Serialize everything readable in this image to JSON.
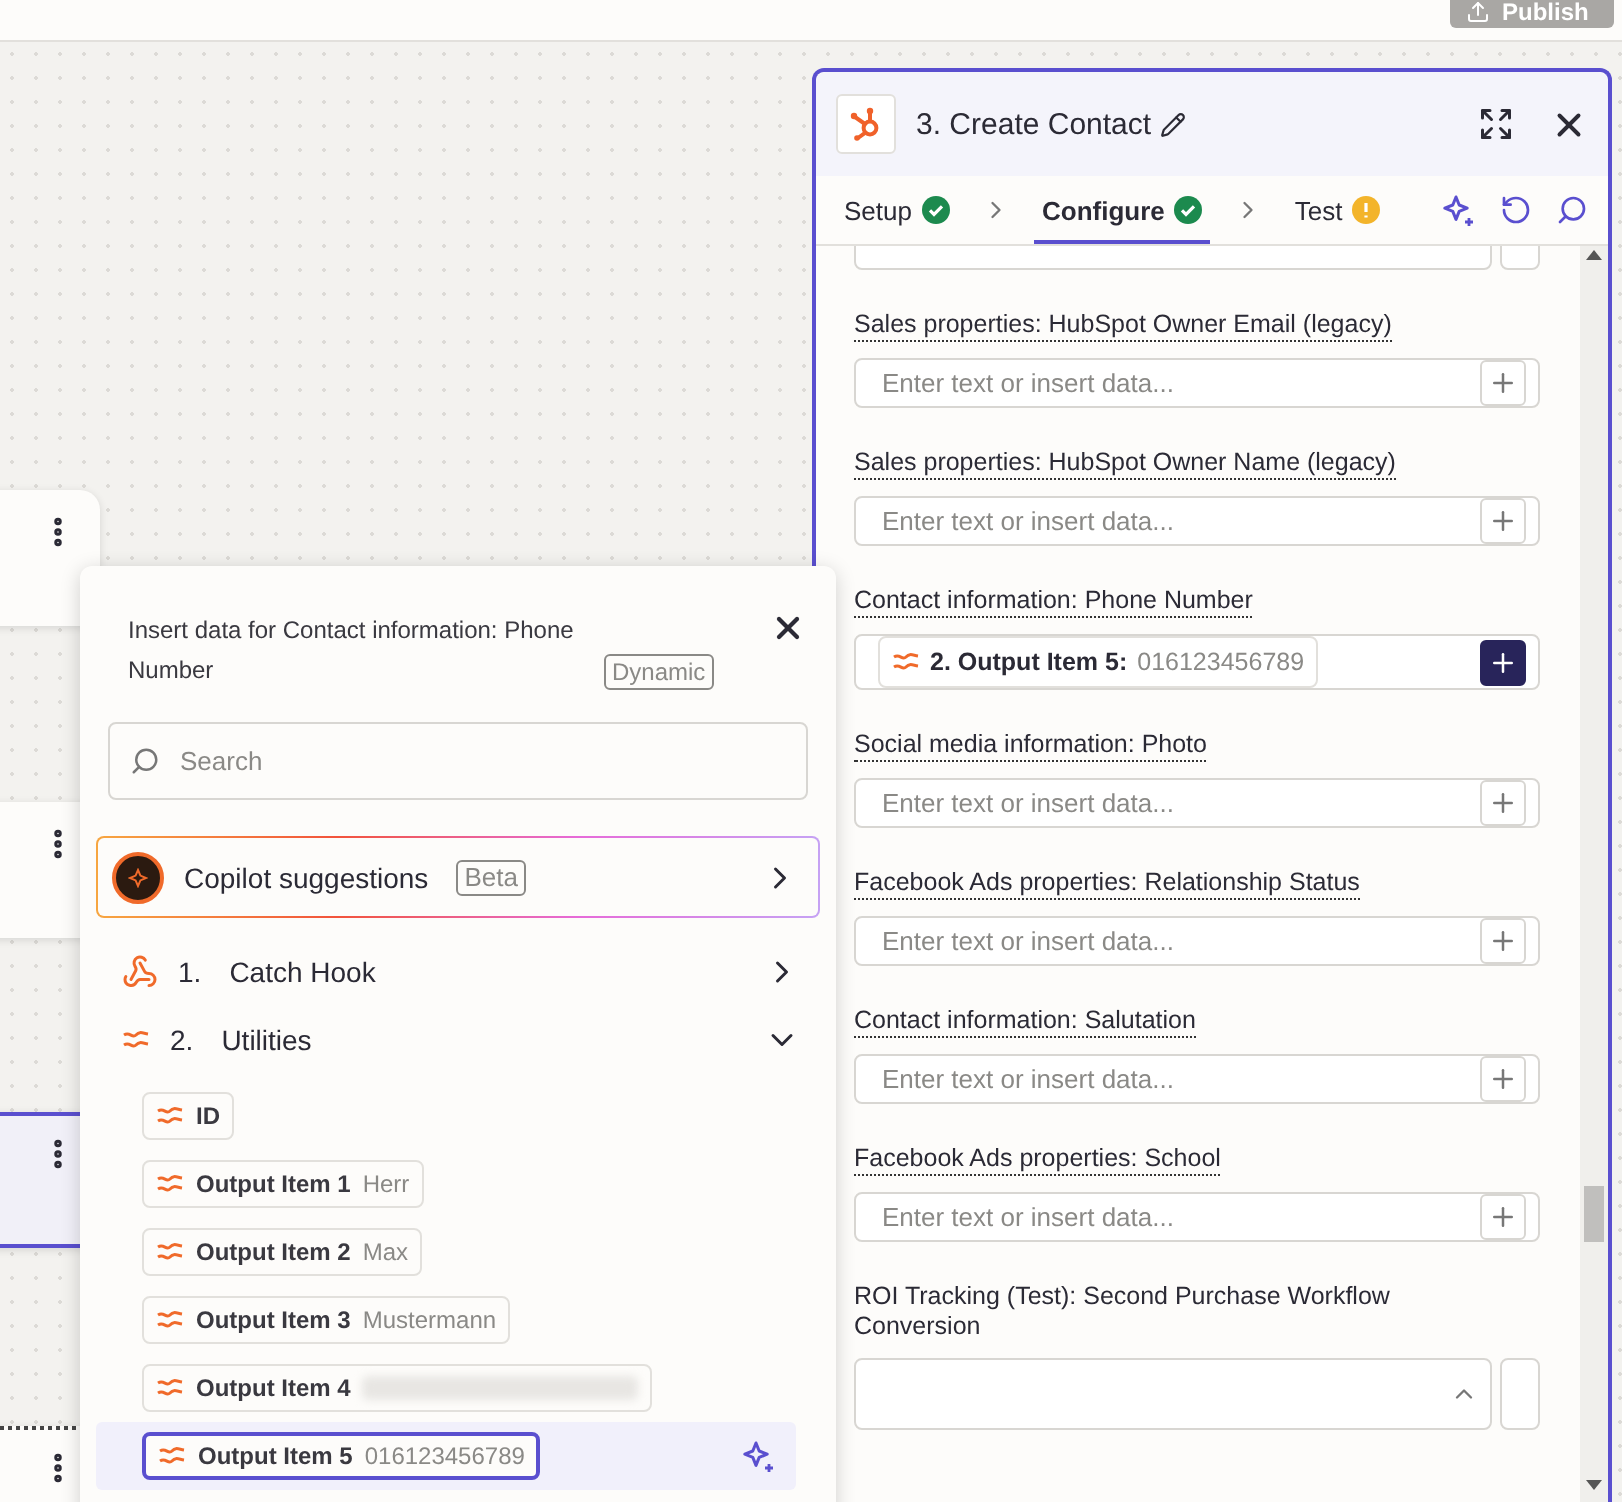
{
  "publish_button": {
    "label": "Publish"
  },
  "canvas": {
    "nodes": [
      {
        "selected": false
      },
      {
        "selected": false
      },
      {
        "selected": true
      },
      {
        "selected": false
      }
    ]
  },
  "panel": {
    "title": "3. Create Contact",
    "tabs": [
      {
        "label": "Setup",
        "kind": "done",
        "selected": false
      },
      {
        "label": "Configure",
        "kind": "done",
        "selected": true
      },
      {
        "label": "Test",
        "kind": "warning",
        "selected": false
      }
    ],
    "fields": [
      {
        "kind": "text",
        "label": "Sales properties: HubSpot Owner Email (legacy)",
        "placeholder": "Enter text or insert data..."
      },
      {
        "kind": "text",
        "label": "Sales properties: HubSpot Owner Name (legacy)",
        "placeholder": "Enter text or insert data..."
      },
      {
        "kind": "mapped",
        "label": "Contact information: Phone Number",
        "token": {
          "step": "2. Output Item 5:",
          "value": "016123456789"
        }
      },
      {
        "kind": "text",
        "label": "Social media information: Photo",
        "placeholder": "Enter text or insert data..."
      },
      {
        "kind": "text",
        "label": "Facebook Ads properties: Relationship Status",
        "placeholder": "Enter text or insert data..."
      },
      {
        "kind": "text",
        "label": "Contact information: Salutation",
        "placeholder": "Enter text or insert data..."
      },
      {
        "kind": "text",
        "label": "Facebook Ads properties: School",
        "placeholder": "Enter text or insert data..."
      },
      {
        "kind": "select",
        "label": "ROI Tracking (Test): Second Purchase Workflow Conversion"
      }
    ]
  },
  "popover": {
    "title": "Insert data for Contact information: Phone Number",
    "badge": "Dynamic",
    "search": {
      "placeholder": "Search"
    },
    "copilot": {
      "label": "Copilot suggestions",
      "badge": "Beta"
    },
    "steps": [
      {
        "kind": "webhook",
        "number": "1.",
        "label": "Catch Hook",
        "expanded": false
      },
      {
        "kind": "utilities",
        "number": "2.",
        "label": "Utilities",
        "expanded": true,
        "items": [
          {
            "label": "ID",
            "selected": false
          },
          {
            "label": "Output Item 1",
            "value": "Herr",
            "selected": false
          },
          {
            "label": "Output Item 2",
            "value": "Max",
            "selected": false
          },
          {
            "label": "Output Item 3",
            "value": "Mustermann",
            "selected": false
          },
          {
            "label": "Output Item 4",
            "redacted": true,
            "selected": false
          },
          {
            "label": "Output Item 5",
            "value": "016123456789",
            "selected": true
          }
        ]
      }
    ]
  }
}
